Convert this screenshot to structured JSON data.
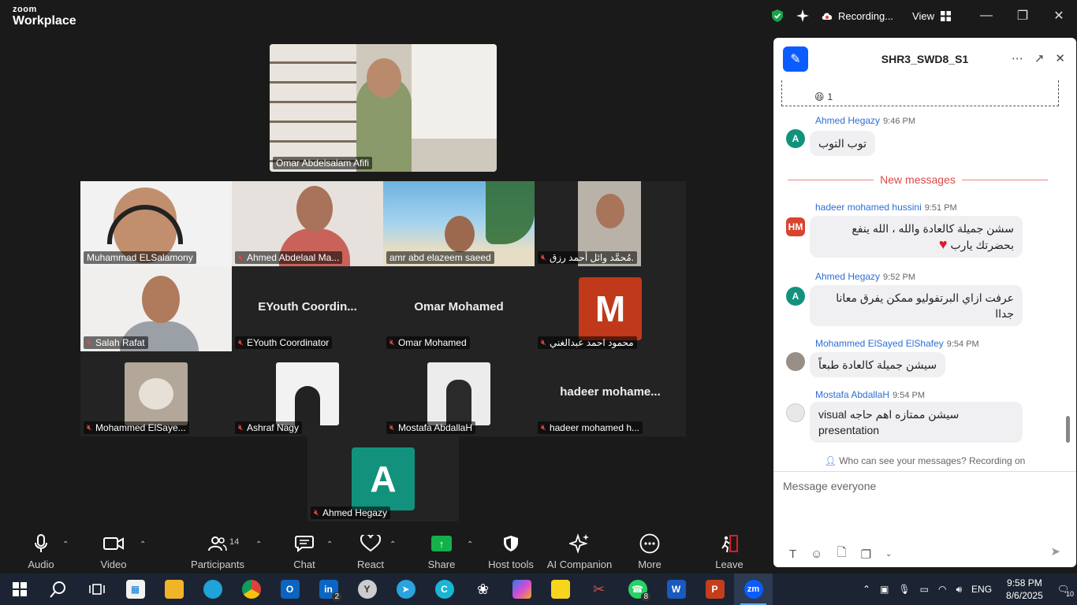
{
  "app": {
    "logo_line1": "zoom",
    "logo_line2": "Workplace"
  },
  "titlebar": {
    "recording": "Recording...",
    "view": "View"
  },
  "tiles": {
    "top": "Omar Abdelsalam Afifi",
    "grid": [
      "Muhammad ELSalamony",
      "Ahmed Abdelaal Ma...",
      "amr abd elazeem saeed",
      "مُحمَّد وائل أحمد رزق.",
      "Salah Rafat",
      "EYouth Coordinator",
      "Omar Mohamed",
      "محمود احمد عبدالغني",
      "Mohammed ElSaye...",
      "Ashraf Nagy",
      "Mostafa AbdallaH",
      "hadeer mohamed h..."
    ],
    "big_names": {
      "eyouth": "EYouth  Coordin...",
      "omar": "Omar Mohamed",
      "hadeer": "hadeer  mohame..."
    },
    "avatar_m": "M",
    "bottom": "Ahmed Hegazy",
    "avatar_a": "A"
  },
  "toolbar": {
    "audio": "Audio",
    "video": "Video",
    "participants": "Participants",
    "participants_count": "14",
    "chat": "Chat",
    "react": "React",
    "share": "Share",
    "host_tools": "Host tools",
    "ai_companion": "AI Companion",
    "more": "More",
    "leave": "Leave"
  },
  "chat": {
    "title": "SHR3_SWD8_S1",
    "reaction_count": "1",
    "new_messages": "New messages",
    "messages": [
      {
        "initials": "A",
        "name": "Ahmed Hegazy",
        "time": "9:46 PM",
        "text": "توب التوب",
        "avatar_color": "#12927d"
      },
      {
        "initials": "HM",
        "name": "hadeer mohamed hussini",
        "time": "9:51 PM",
        "text": "سشن جميلة كالعادة والله ، الله ينفع بحضرتك يارب",
        "heart": "♥",
        "avatar_color": "#d9432f"
      },
      {
        "initials": "A",
        "name": "Ahmed Hegazy",
        "time": "9:52 PM",
        "text": "عرفت ازاي البرتفوليو ممكن يفرق معانا جداا",
        "avatar_color": "#12927d"
      },
      {
        "initials": "",
        "name": "Mohammed ElSayed ElShafey",
        "time": "9:54 PM",
        "text": "سيشن جميلة كالعادة طبعاً",
        "avatar_color": "#9a8f86"
      },
      {
        "initials": "",
        "name": "Mostafa AbdallaH",
        "time": "9:54 PM",
        "text_line1": "visual  سيشن ممتازه اهم حاجه",
        "text_line2": "presentation",
        "avatar_color": "#e8e8e8"
      }
    ],
    "privacy": "Who can see your messages? Recording on",
    "input_placeholder": "Message everyone"
  },
  "taskbar": {
    "outlook_badge": "",
    "linkedin_count": "2",
    "whatsapp_count": "8",
    "lang": "ENG",
    "time": "9:58 PM",
    "date": "8/6/2025",
    "notif_count": "10"
  }
}
